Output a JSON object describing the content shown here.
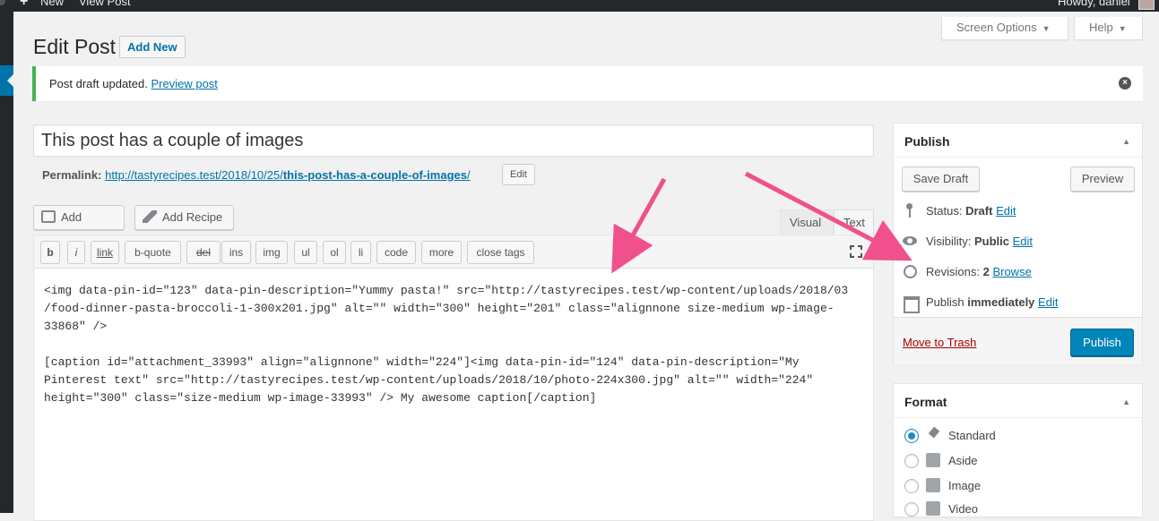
{
  "admin_bar": {
    "new_icon": "+",
    "new_label": "New",
    "view_post_label": "View Post",
    "howdy_text": "Howdy, daniel"
  },
  "screen_meta": {
    "screen_options_label": "Screen Options",
    "help_label": "Help",
    "caret": "▼"
  },
  "header": {
    "title": "Edit Post",
    "add_new_label": "Add New"
  },
  "notice": {
    "text": "Post draft updated.",
    "link_text": "Preview post",
    "dismiss_icon": "×"
  },
  "post": {
    "title": "This post has a couple of images",
    "permalink_label": "Permalink:",
    "permalink_base": "http://tastyrecipes.test/2018/10/25/",
    "permalink_slug": "this-post-has-a-couple-of-images",
    "permalink_end": "/",
    "permalink_edit_label": "Edit"
  },
  "media_buttons": {
    "add_media_label": "Add Media",
    "add_recipe_label": "Add Recipe"
  },
  "editor_tabs": {
    "visual_label": "Visual",
    "text_label": "Text"
  },
  "quicktags": [
    "b",
    "i",
    "link",
    "b-quote",
    "del",
    "ins",
    "img",
    "ul",
    "ol",
    "li",
    "code",
    "more",
    "close tags"
  ],
  "editor_content": "<img data-pin-id=\"123\" data-pin-description=\"Yummy pasta!\" src=\"http://tastyrecipes.test/wp-content/uploads/2018/03\n/food-dinner-pasta-broccoli-1-300x201.jpg\" alt=\"\" width=\"300\" height=\"201\" class=\"alignnone size-medium wp-image-\n33868\" />\n\n[caption id=\"attachment_33993\" align=\"alignnone\" width=\"224\"]<img data-pin-id=\"124\" data-pin-description=\"My\nPinterest text\" src=\"http://tastyrecipes.test/wp-content/uploads/2018/10/photo-224x300.jpg\" alt=\"\" width=\"224\"\nheight=\"300\" class=\"size-medium wp-image-33993\" /> My awesome caption[/caption]",
  "publish_box": {
    "title": "Publish",
    "toggle_icon": "▲",
    "save_draft_label": "Save Draft",
    "preview_label": "Preview",
    "status_label": "Status:",
    "status_value": "Draft",
    "status_edit": "Edit",
    "visibility_label": "Visibility:",
    "visibility_value": "Public",
    "visibility_edit": "Edit",
    "revisions_label": "Revisions:",
    "revisions_value": "2",
    "revisions_browse": "Browse",
    "publish_label": "Publish",
    "publish_when": "immediately",
    "publish_edit": "Edit",
    "trash_label": "Move to Trash",
    "publish_button_label": "Publish"
  },
  "format_box": {
    "title": "Format",
    "toggle_icon": "▲",
    "options": [
      "Standard",
      "Aside",
      "Image",
      "Video"
    ],
    "selected": "Standard"
  },
  "colors": {
    "admin_bar": "#23282d",
    "primary_button": "#0085ba",
    "link": "#0073aa",
    "notice_success": "#46b450",
    "annotation_arrow": "#f0508c"
  }
}
